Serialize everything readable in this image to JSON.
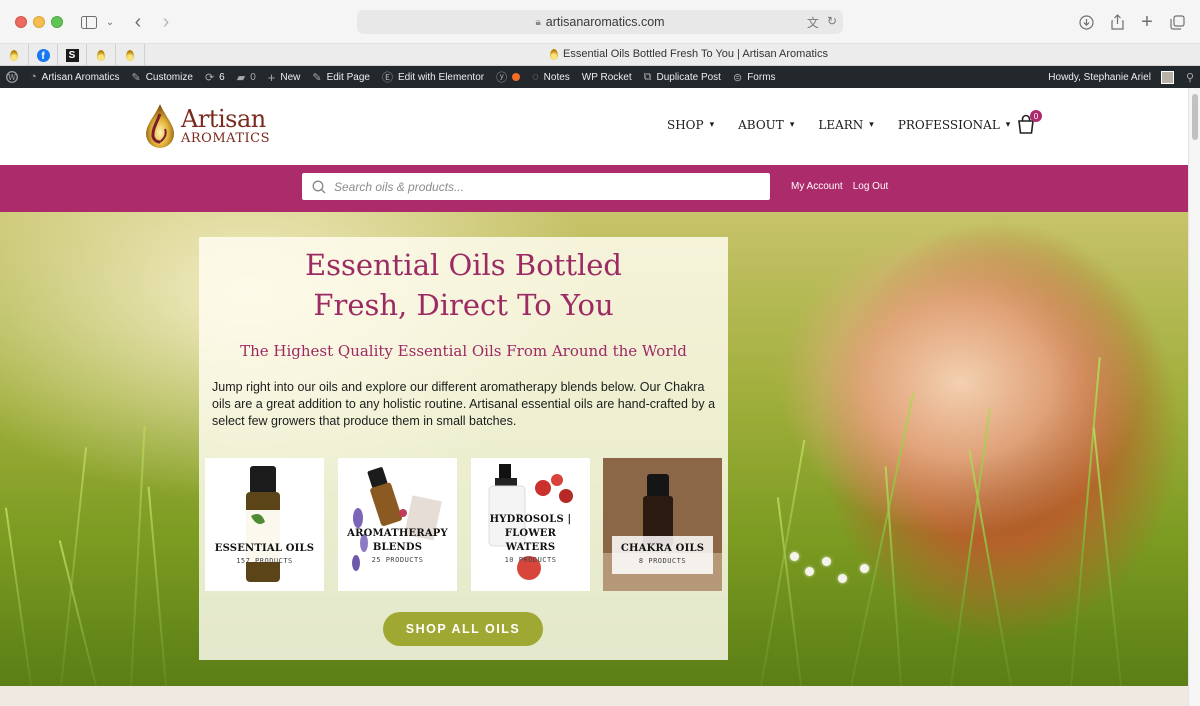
{
  "browser": {
    "url": "artisanaromatics.com",
    "tab_title": "Essential Oils Bottled Fresh To You | Artisan Aromatics"
  },
  "admin_bar": {
    "site_name": "Artisan Aromatics",
    "customize": "Customize",
    "updates_count": "6",
    "comments_count": "0",
    "new": "New",
    "edit_page": "Edit Page",
    "edit_elementor": "Edit with Elementor",
    "notes": "Notes",
    "wp_rocket": "WP Rocket",
    "duplicate_post": "Duplicate Post",
    "forms": "Forms",
    "howdy": "Howdy, Stephanie Ariel"
  },
  "header": {
    "logo_line1": "Artisan",
    "logo_line2": "AROMATICS",
    "nav": [
      "SHOP",
      "ABOUT",
      "LEARN",
      "PROFESSIONAL"
    ],
    "cart_count": "0"
  },
  "search": {
    "placeholder": "Search oils & products...",
    "my_account": "My Account",
    "log_out": "Log Out"
  },
  "hero": {
    "title_line1": "Essential Oils Bottled",
    "title_line2": "Fresh, Direct To You",
    "subtitle": "The Highest Quality Essential Oils From Around the World",
    "body": "Jump right into our oils and explore our different aromatherapy blends below. Our Chakra oils are a great addition to any holistic routine. Artisanal essential oils are hand-crafted by a select few growers that produce them in small batches.",
    "categories": [
      {
        "name_l1": "ESSENTIAL OILS",
        "name_l2": "",
        "count": "157 PRODUCTS"
      },
      {
        "name_l1": "AROMATHERAPY",
        "name_l2": "BLENDS",
        "count": "25 PRODUCTS"
      },
      {
        "name_l1": "HYDROSOLS |",
        "name_l2": "FLOWER",
        "name_l3": "WATERS",
        "count": "10 PRODUCTS"
      },
      {
        "name_l1": "CHAKRA OILS",
        "name_l2": "",
        "count": "8 PRODUCTS"
      }
    ],
    "cta": "SHOP ALL OILS"
  },
  "colors": {
    "brand_magenta": "#ac2b6b",
    "cta_green": "#9fa833",
    "admin_bar": "#23282d"
  }
}
